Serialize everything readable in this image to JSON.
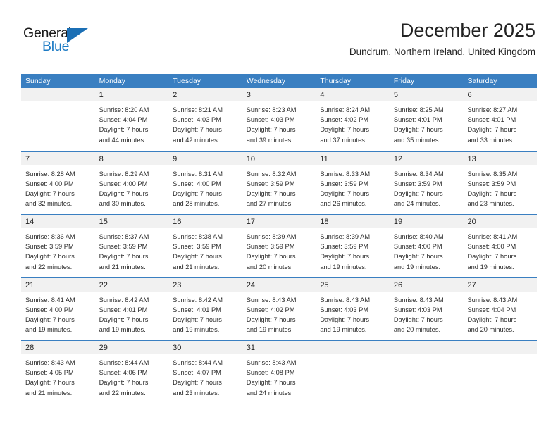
{
  "brand": {
    "name_line1": "General",
    "name_line2": "Blue",
    "triangle_icon": "triangle-logo-icon",
    "color_blue": "#1b7ac4",
    "color_dark": "#1a1a1a"
  },
  "header": {
    "title": "December 2025",
    "subtitle": "Dundrum, Northern Ireland, United Kingdom"
  },
  "theme": {
    "header_band": "#3a7fc1",
    "date_band": "#f1f1f1",
    "text": "#2b2b2b"
  },
  "weekdays": [
    "Sunday",
    "Monday",
    "Tuesday",
    "Wednesday",
    "Thursday",
    "Friday",
    "Saturday"
  ],
  "weeks": [
    [
      {
        "day": "",
        "lines": [
          "",
          "",
          "",
          ""
        ]
      },
      {
        "day": "1",
        "lines": [
          "Sunrise: 8:20 AM",
          "Sunset: 4:04 PM",
          "Daylight: 7 hours",
          "and 44 minutes."
        ]
      },
      {
        "day": "2",
        "lines": [
          "Sunrise: 8:21 AM",
          "Sunset: 4:03 PM",
          "Daylight: 7 hours",
          "and 42 minutes."
        ]
      },
      {
        "day": "3",
        "lines": [
          "Sunrise: 8:23 AM",
          "Sunset: 4:03 PM",
          "Daylight: 7 hours",
          "and 39 minutes."
        ]
      },
      {
        "day": "4",
        "lines": [
          "Sunrise: 8:24 AM",
          "Sunset: 4:02 PM",
          "Daylight: 7 hours",
          "and 37 minutes."
        ]
      },
      {
        "day": "5",
        "lines": [
          "Sunrise: 8:25 AM",
          "Sunset: 4:01 PM",
          "Daylight: 7 hours",
          "and 35 minutes."
        ]
      },
      {
        "day": "6",
        "lines": [
          "Sunrise: 8:27 AM",
          "Sunset: 4:01 PM",
          "Daylight: 7 hours",
          "and 33 minutes."
        ]
      }
    ],
    [
      {
        "day": "7",
        "lines": [
          "Sunrise: 8:28 AM",
          "Sunset: 4:00 PM",
          "Daylight: 7 hours",
          "and 32 minutes."
        ]
      },
      {
        "day": "8",
        "lines": [
          "Sunrise: 8:29 AM",
          "Sunset: 4:00 PM",
          "Daylight: 7 hours",
          "and 30 minutes."
        ]
      },
      {
        "day": "9",
        "lines": [
          "Sunrise: 8:31 AM",
          "Sunset: 4:00 PM",
          "Daylight: 7 hours",
          "and 28 minutes."
        ]
      },
      {
        "day": "10",
        "lines": [
          "Sunrise: 8:32 AM",
          "Sunset: 3:59 PM",
          "Daylight: 7 hours",
          "and 27 minutes."
        ]
      },
      {
        "day": "11",
        "lines": [
          "Sunrise: 8:33 AM",
          "Sunset: 3:59 PM",
          "Daylight: 7 hours",
          "and 26 minutes."
        ]
      },
      {
        "day": "12",
        "lines": [
          "Sunrise: 8:34 AM",
          "Sunset: 3:59 PM",
          "Daylight: 7 hours",
          "and 24 minutes."
        ]
      },
      {
        "day": "13",
        "lines": [
          "Sunrise: 8:35 AM",
          "Sunset: 3:59 PM",
          "Daylight: 7 hours",
          "and 23 minutes."
        ]
      }
    ],
    [
      {
        "day": "14",
        "lines": [
          "Sunrise: 8:36 AM",
          "Sunset: 3:59 PM",
          "Daylight: 7 hours",
          "and 22 minutes."
        ]
      },
      {
        "day": "15",
        "lines": [
          "Sunrise: 8:37 AM",
          "Sunset: 3:59 PM",
          "Daylight: 7 hours",
          "and 21 minutes."
        ]
      },
      {
        "day": "16",
        "lines": [
          "Sunrise: 8:38 AM",
          "Sunset: 3:59 PM",
          "Daylight: 7 hours",
          "and 21 minutes."
        ]
      },
      {
        "day": "17",
        "lines": [
          "Sunrise: 8:39 AM",
          "Sunset: 3:59 PM",
          "Daylight: 7 hours",
          "and 20 minutes."
        ]
      },
      {
        "day": "18",
        "lines": [
          "Sunrise: 8:39 AM",
          "Sunset: 3:59 PM",
          "Daylight: 7 hours",
          "and 19 minutes."
        ]
      },
      {
        "day": "19",
        "lines": [
          "Sunrise: 8:40 AM",
          "Sunset: 4:00 PM",
          "Daylight: 7 hours",
          "and 19 minutes."
        ]
      },
      {
        "day": "20",
        "lines": [
          "Sunrise: 8:41 AM",
          "Sunset: 4:00 PM",
          "Daylight: 7 hours",
          "and 19 minutes."
        ]
      }
    ],
    [
      {
        "day": "21",
        "lines": [
          "Sunrise: 8:41 AM",
          "Sunset: 4:00 PM",
          "Daylight: 7 hours",
          "and 19 minutes."
        ]
      },
      {
        "day": "22",
        "lines": [
          "Sunrise: 8:42 AM",
          "Sunset: 4:01 PM",
          "Daylight: 7 hours",
          "and 19 minutes."
        ]
      },
      {
        "day": "23",
        "lines": [
          "Sunrise: 8:42 AM",
          "Sunset: 4:01 PM",
          "Daylight: 7 hours",
          "and 19 minutes."
        ]
      },
      {
        "day": "24",
        "lines": [
          "Sunrise: 8:43 AM",
          "Sunset: 4:02 PM",
          "Daylight: 7 hours",
          "and 19 minutes."
        ]
      },
      {
        "day": "25",
        "lines": [
          "Sunrise: 8:43 AM",
          "Sunset: 4:03 PM",
          "Daylight: 7 hours",
          "and 19 minutes."
        ]
      },
      {
        "day": "26",
        "lines": [
          "Sunrise: 8:43 AM",
          "Sunset: 4:03 PM",
          "Daylight: 7 hours",
          "and 20 minutes."
        ]
      },
      {
        "day": "27",
        "lines": [
          "Sunrise: 8:43 AM",
          "Sunset: 4:04 PM",
          "Daylight: 7 hours",
          "and 20 minutes."
        ]
      }
    ],
    [
      {
        "day": "28",
        "lines": [
          "Sunrise: 8:43 AM",
          "Sunset: 4:05 PM",
          "Daylight: 7 hours",
          "and 21 minutes."
        ]
      },
      {
        "day": "29",
        "lines": [
          "Sunrise: 8:44 AM",
          "Sunset: 4:06 PM",
          "Daylight: 7 hours",
          "and 22 minutes."
        ]
      },
      {
        "day": "30",
        "lines": [
          "Sunrise: 8:44 AM",
          "Sunset: 4:07 PM",
          "Daylight: 7 hours",
          "and 23 minutes."
        ]
      },
      {
        "day": "31",
        "lines": [
          "Sunrise: 8:43 AM",
          "Sunset: 4:08 PM",
          "Daylight: 7 hours",
          "and 24 minutes."
        ]
      },
      {
        "day": "",
        "lines": [
          "",
          "",
          "",
          ""
        ]
      },
      {
        "day": "",
        "lines": [
          "",
          "",
          "",
          ""
        ]
      },
      {
        "day": "",
        "lines": [
          "",
          "",
          "",
          ""
        ]
      }
    ]
  ]
}
